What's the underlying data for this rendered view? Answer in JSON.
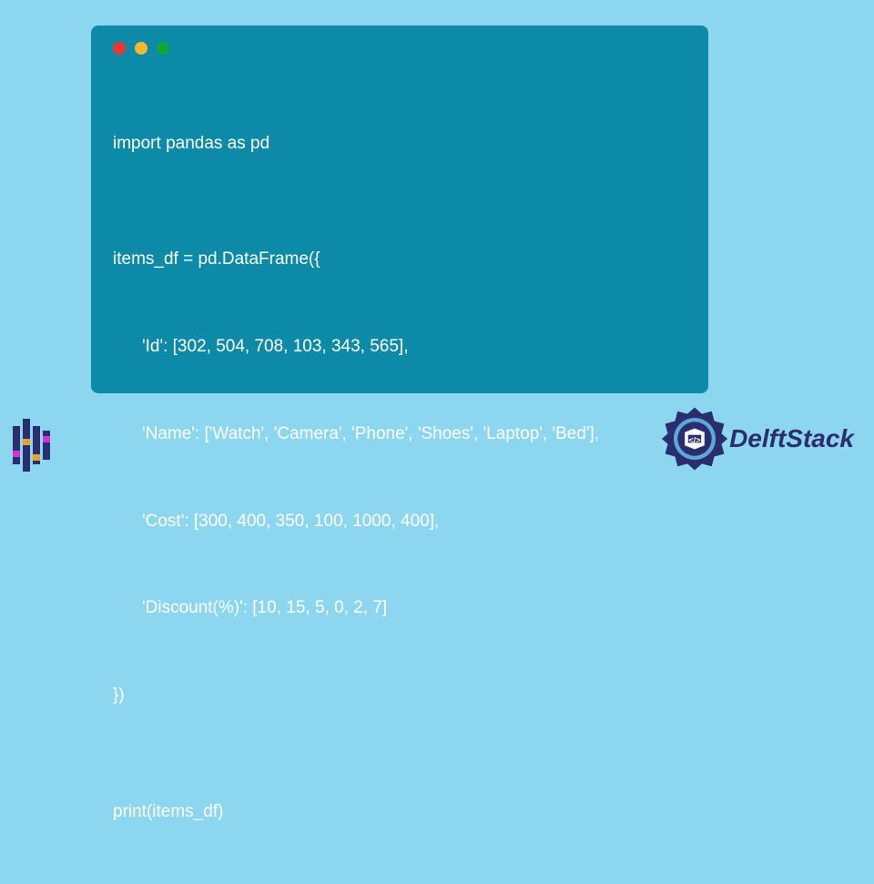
{
  "code": {
    "l1": "import pandas as pd",
    "l2": "items_df = pd.DataFrame({",
    "l3": "'Id': [302, 504, 708, 103, 343, 565],",
    "l4": "'Name': ['Watch', 'Camera', 'Phone', 'Shoes', 'Laptop', 'Bed'],",
    "l5": "'Cost': [300, 400, 350, 100, 1000, 400],",
    "l6": "'Discount(%)': [10, 15, 5, 0, 2, 7]",
    "l7": "})",
    "l8": "print(items_df)"
  },
  "branding": {
    "name": "DelftStack"
  },
  "window_controls": {
    "red": "#ed3730",
    "yellow": "#f7b92b",
    "green": "#10a63a"
  }
}
